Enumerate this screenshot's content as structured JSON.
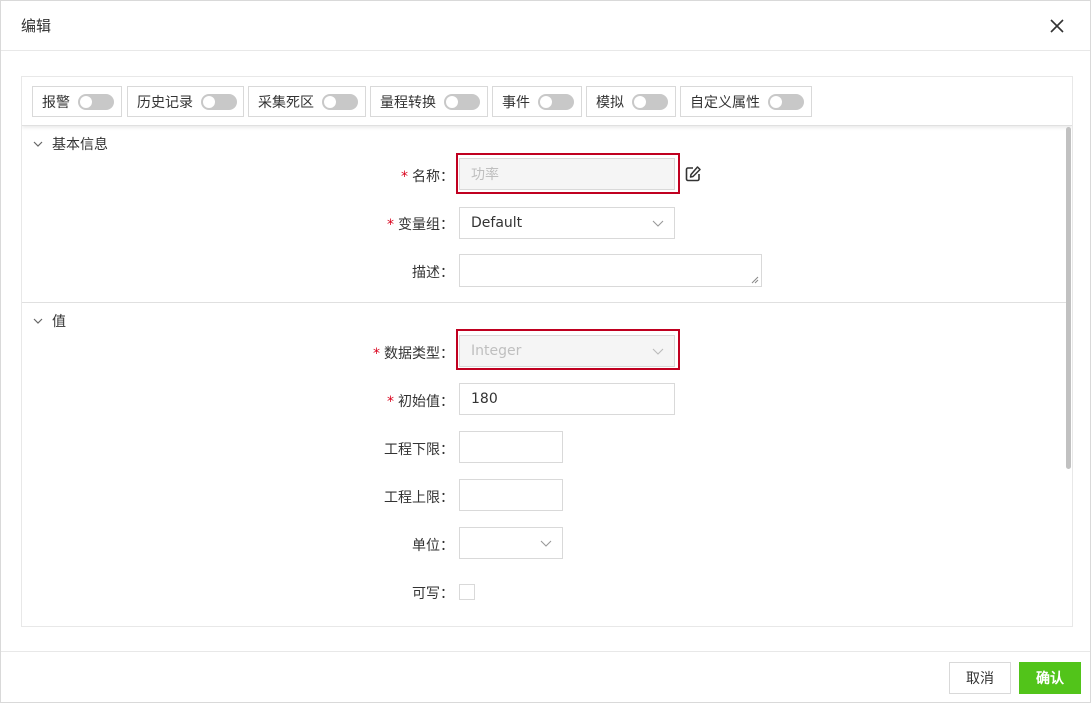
{
  "dialog": {
    "title": "编辑"
  },
  "toggles": [
    {
      "label": "报警",
      "on": false
    },
    {
      "label": "历史记录",
      "on": false
    },
    {
      "label": "采集死区",
      "on": false
    },
    {
      "label": "量程转换",
      "on": false
    },
    {
      "label": "事件",
      "on": false
    },
    {
      "label": "模拟",
      "on": false
    },
    {
      "label": "自定义属性",
      "on": false
    }
  ],
  "basic": {
    "section_title": "基本信息",
    "name_label": "名称：",
    "name_placeholder": "功率",
    "group_label": "变量组：",
    "group_value": "Default",
    "desc_label": "描述："
  },
  "value": {
    "section_title": "值",
    "type_label": "数据类型：",
    "type_value": "Integer",
    "init_label": "初始值：",
    "init_value": "180",
    "low_label": "工程下限：",
    "high_label": "工程上限：",
    "unit_label": "单位：",
    "writable_label": "可写："
  },
  "required_mark": "*",
  "buttons": {
    "cancel": "取消",
    "confirm": "确认"
  },
  "colors": {
    "accent": "#52c41a",
    "required": "#d9001b",
    "highlight": "#c00020"
  }
}
